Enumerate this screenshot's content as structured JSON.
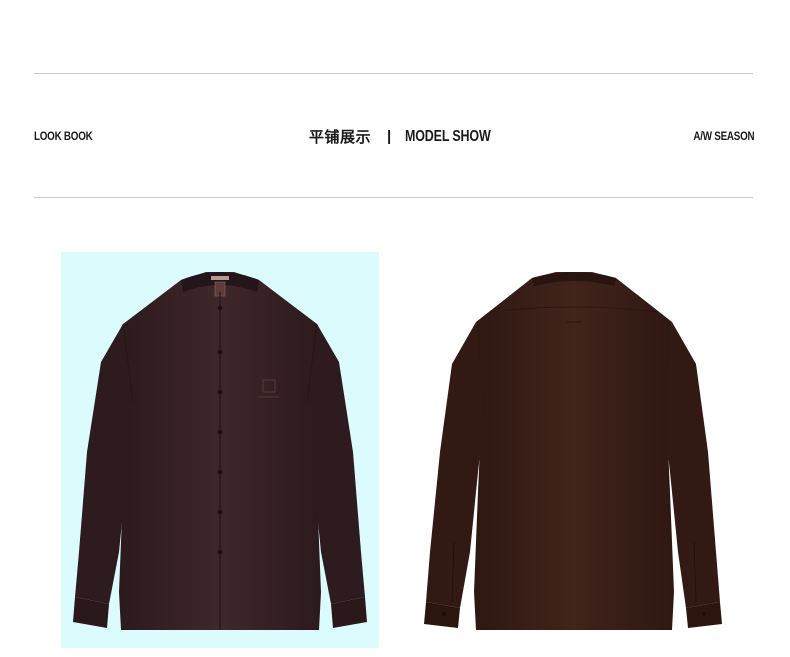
{
  "header": {
    "left_label": "LOOK BOOK",
    "title_cn": "平铺展示",
    "separator": "|",
    "title_en": "MODEL SHOW",
    "right_label": "A/W SEASON"
  },
  "products": [
    {
      "view": "front",
      "background": "#dcfbfd",
      "color": "#3a2226"
    },
    {
      "view": "back",
      "background": "#ffffff",
      "color": "#3b1d17"
    }
  ],
  "colors": {
    "rule": "#c9c9c9",
    "text": "#1a1a1a"
  }
}
